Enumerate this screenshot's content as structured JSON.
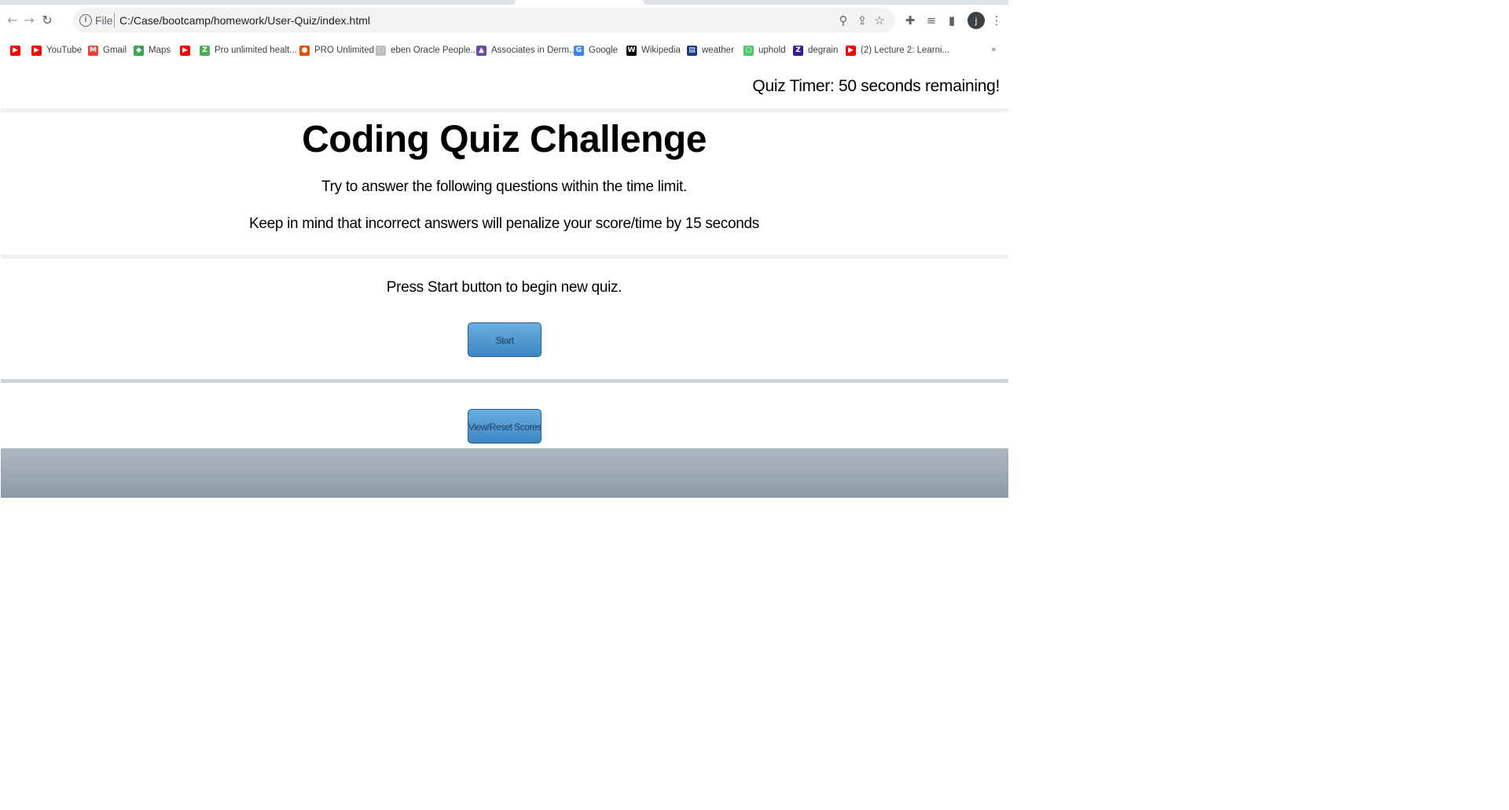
{
  "browser": {
    "url_scheme_label": "File",
    "url": "C:/Case/bootcamp/homework/User-Quiz/index.html",
    "avatar_letter": "j",
    "icons": {
      "back": "back-arrow-icon",
      "forward": "forward-arrow-icon",
      "reload": "reload-icon",
      "info": "info-icon",
      "zoom": "zoom-icon",
      "share": "share-icon",
      "star": "star-icon",
      "extensions": "puzzle-icon",
      "reading_list": "reading-list-icon",
      "side_panel": "side-panel-icon",
      "menu": "kebab-menu-icon"
    }
  },
  "bookmarks": [
    {
      "label": "",
      "icon": "youtube-icon",
      "color": "#ff0000"
    },
    {
      "label": "YouTube",
      "icon": "youtube-icon",
      "color": "#ff0000"
    },
    {
      "label": "Gmail",
      "icon": "gmail-icon",
      "color": "#ea4335"
    },
    {
      "label": "Maps",
      "icon": "maps-icon",
      "color": "#34a853"
    },
    {
      "label": "",
      "icon": "youtube-icon",
      "color": "#ff0000"
    },
    {
      "label": "Pro unlimited healt...",
      "icon": "pro-unlimited-icon",
      "color": "#4caf50"
    },
    {
      "label": "PRO Unlimited",
      "icon": "pro-icon",
      "color": "#e65100"
    },
    {
      "label": "eben Oracle People...",
      "icon": "oracle-icon",
      "color": "#bdbdbd"
    },
    {
      "label": "Associates in Derm...",
      "icon": "associates-icon",
      "color": "#6a4ba0"
    },
    {
      "label": "Google",
      "icon": "google-icon",
      "color": "#4285f4"
    },
    {
      "label": "Wikipedia",
      "icon": "wikipedia-icon",
      "color": "#000000"
    },
    {
      "label": "weather",
      "icon": "weather-icon",
      "color": "#1a3a8f"
    },
    {
      "label": "uphold",
      "icon": "uphold-icon",
      "color": "#49cc68"
    },
    {
      "label": "degrain",
      "icon": "degrain-icon",
      "color": "#3b1d8f"
    },
    {
      "label": "(2) Lecture 2: Learni...",
      "icon": "youtube-icon",
      "color": "#ff0000"
    }
  ],
  "bookmarks_more": "»",
  "quiz": {
    "timer_text": "Quiz Timer: 50 seconds remaining!",
    "title": "Coding Quiz Challenge",
    "instruction_1": "Try to answer the following questions within the time limit.",
    "instruction_2": "Keep in mind that incorrect answers will penalize your score/time by 15 seconds",
    "start_prompt": "Press Start button to begin new quiz.",
    "start_label": "Start",
    "scores_label": "View/Reset Scores"
  },
  "colors": {
    "button_top": "#6aaee0",
    "button_bottom": "#3d87c5",
    "footer": "#9aa6b1"
  }
}
